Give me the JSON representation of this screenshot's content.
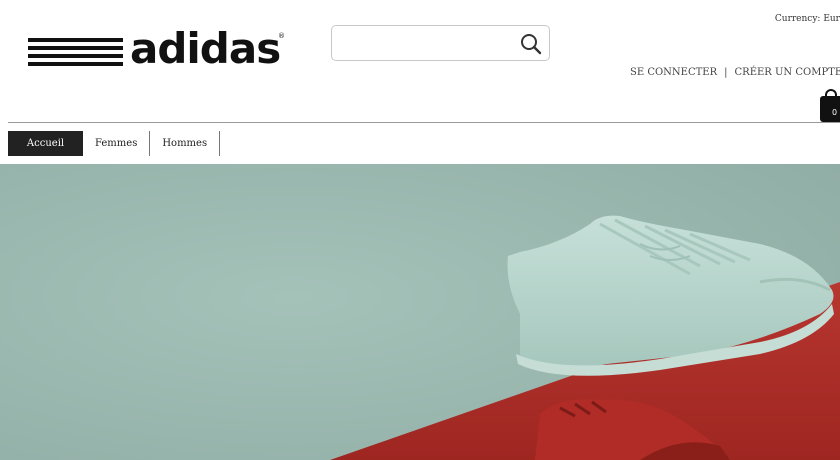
{
  "brand": {
    "name": "adidas",
    "reg_mark": "®"
  },
  "search": {
    "placeholder": "",
    "value": "",
    "icon": "search-icon"
  },
  "header": {
    "currency_label": "Currency: Eur",
    "login_label": "SE CONNECTER",
    "separator": "|",
    "register_label": "CRÉER UN COMPTE"
  },
  "cart": {
    "count": "0",
    "icon": "shopping-bag-icon"
  },
  "nav": {
    "items": [
      {
        "label": "Accueil",
        "active": true
      },
      {
        "label": "Femmes",
        "active": false
      },
      {
        "label": "Hommes",
        "active": false
      }
    ]
  },
  "hero": {
    "colors": {
      "background": "#9cb9b1",
      "red": "#b3312c",
      "shoe_top": "#b8d6cd"
    }
  }
}
